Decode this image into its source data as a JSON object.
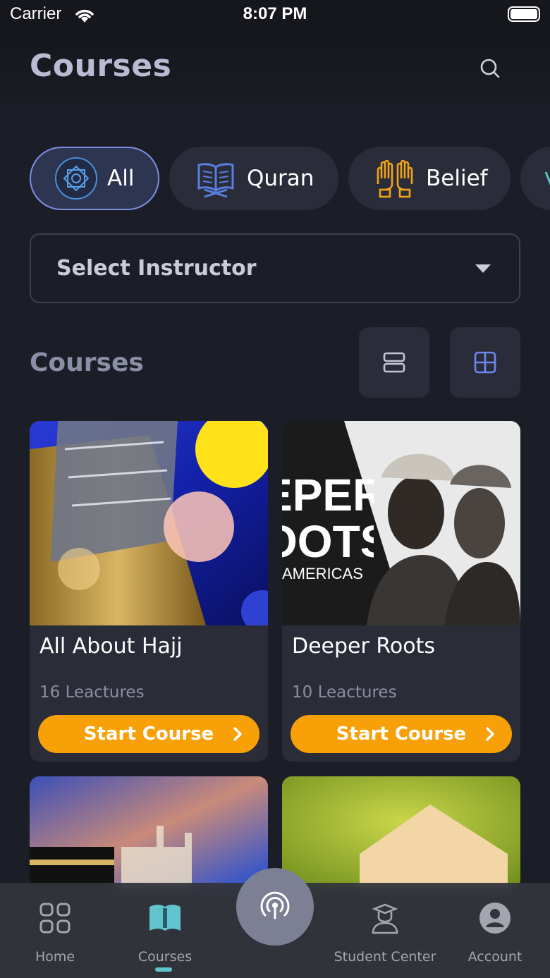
{
  "status_bar": {
    "carrier": "Carrier",
    "time": "8:07 PM"
  },
  "header": {
    "title": "Courses",
    "search_icon": "search-icon"
  },
  "categories": [
    {
      "label": "All",
      "icon": "all-grid-icon",
      "active": true
    },
    {
      "label": "Quran",
      "icon": "quran-book-icon",
      "active": false
    },
    {
      "label": "Belief",
      "icon": "praying-hands-icon",
      "active": false
    }
  ],
  "instructor_select": {
    "label": "Select Instructor"
  },
  "courses_section": {
    "title": "Courses",
    "view_list_icon": "list-view-icon",
    "view_grid_icon": "grid-view-icon"
  },
  "courses": [
    {
      "title": "All About Hajj",
      "lectures": "16 Leactures",
      "button": "Start Course"
    },
    {
      "title": "Deeper Roots",
      "lectures": "10 Leactures",
      "button": "Start Course"
    }
  ],
  "bottom_nav": {
    "items": [
      {
        "label": "Home",
        "icon": "home-grid-icon"
      },
      {
        "label": "Courses",
        "icon": "book-icon"
      },
      {
        "label": "Student Center",
        "icon": "student-icon"
      },
      {
        "label": "Account",
        "icon": "account-icon"
      }
    ],
    "center_icon": "broadcast-icon"
  },
  "colors": {
    "accent": "#f8a007",
    "active_chip_border": "#7c8ee2",
    "background": "#1c1e27"
  }
}
